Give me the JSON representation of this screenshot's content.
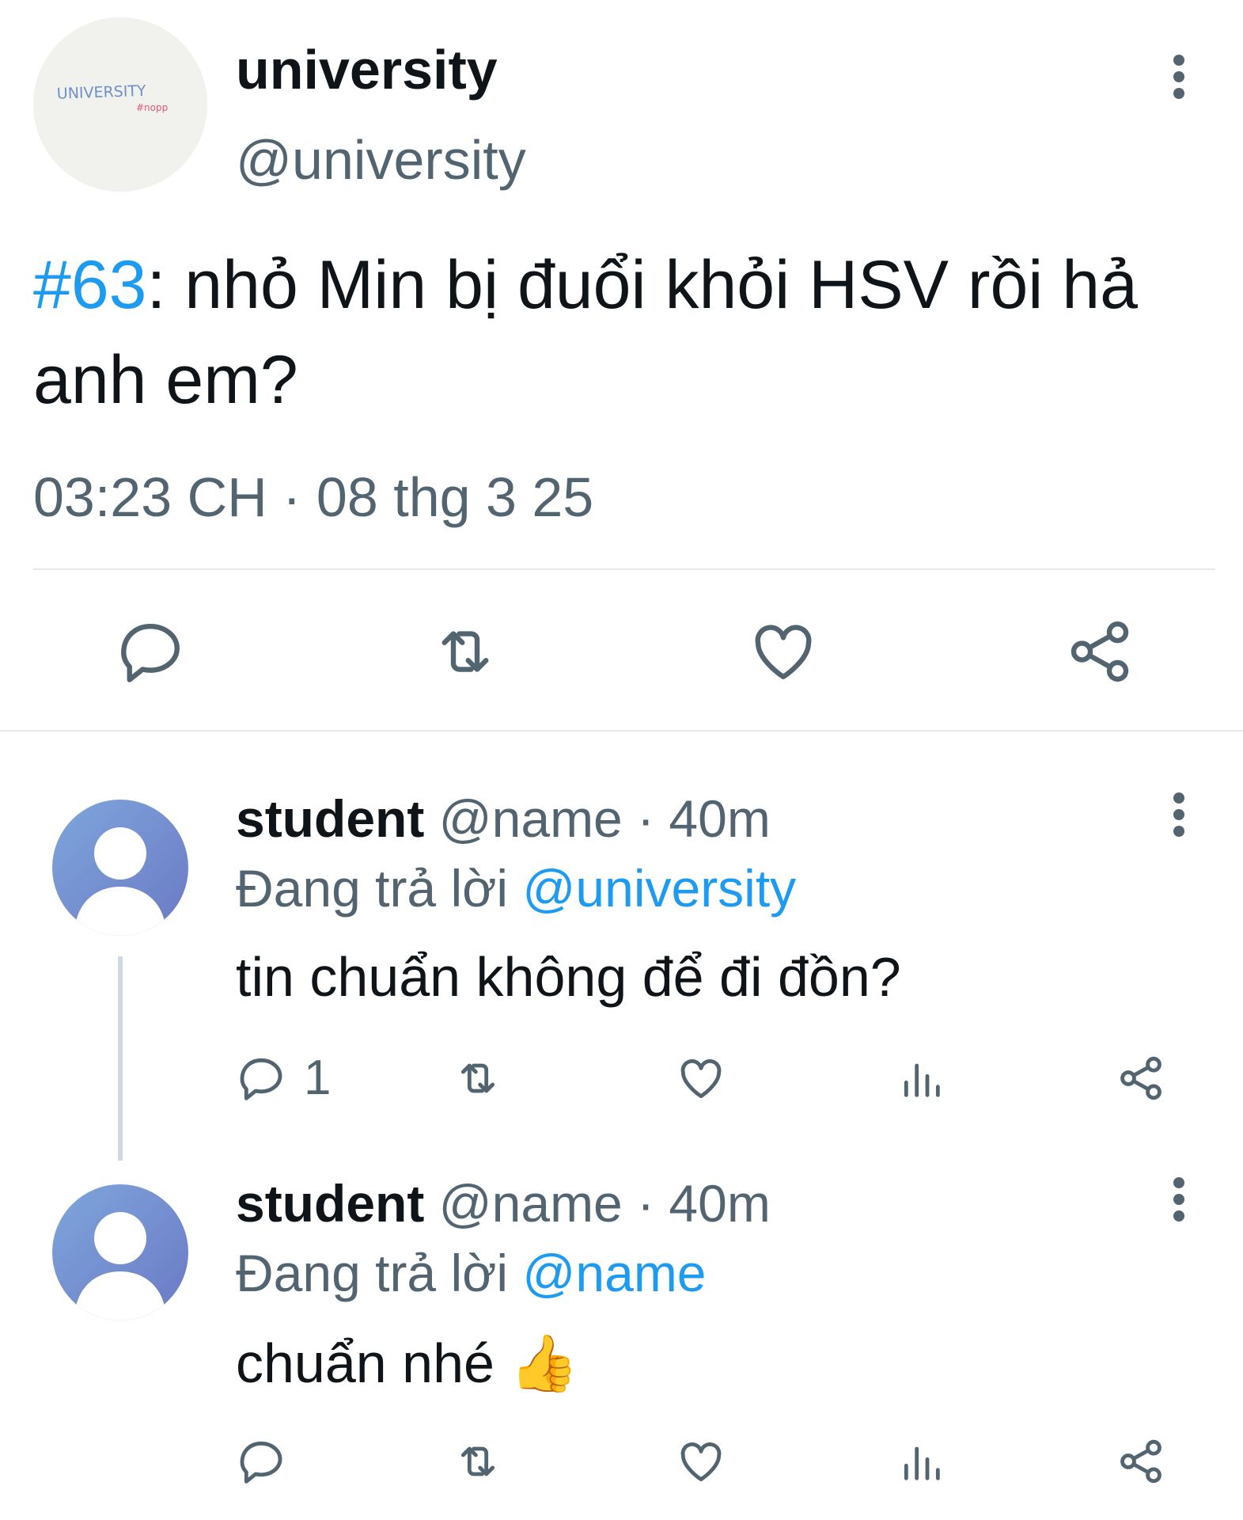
{
  "main_tweet": {
    "avatar_text": "UNIVERSITY",
    "avatar_subtext": "#nopp",
    "display_name": "university",
    "handle": "@university",
    "hashtag": "#63",
    "text_rest": ": nhỏ Min bị đuổi khỏi HSV rồi hả anh em?",
    "timestamp": "03:23 CH · 08 thg 3 25",
    "actions": [
      "reply-icon",
      "retweet-icon",
      "like-icon",
      "share-icon"
    ]
  },
  "replies": [
    {
      "display_name": "student",
      "handle_time": " @name · 40m",
      "replying_prefix": "Đang trả lời ",
      "replying_to": "@university",
      "text": "tin chuẩn không để đi đồn?",
      "reply_count": "1"
    },
    {
      "display_name": "student",
      "handle_time": " @name · 40m",
      "replying_prefix": "Đang trả lời ",
      "replying_to": "@name",
      "text": "chuẩn nhé 👍",
      "reply_count": ""
    }
  ],
  "colors": {
    "accent": "#1d9bf0",
    "secondary_text": "#536471",
    "avatar_gradient_start": "#7ea6dc",
    "avatar_gradient_end": "#6b79c4"
  }
}
